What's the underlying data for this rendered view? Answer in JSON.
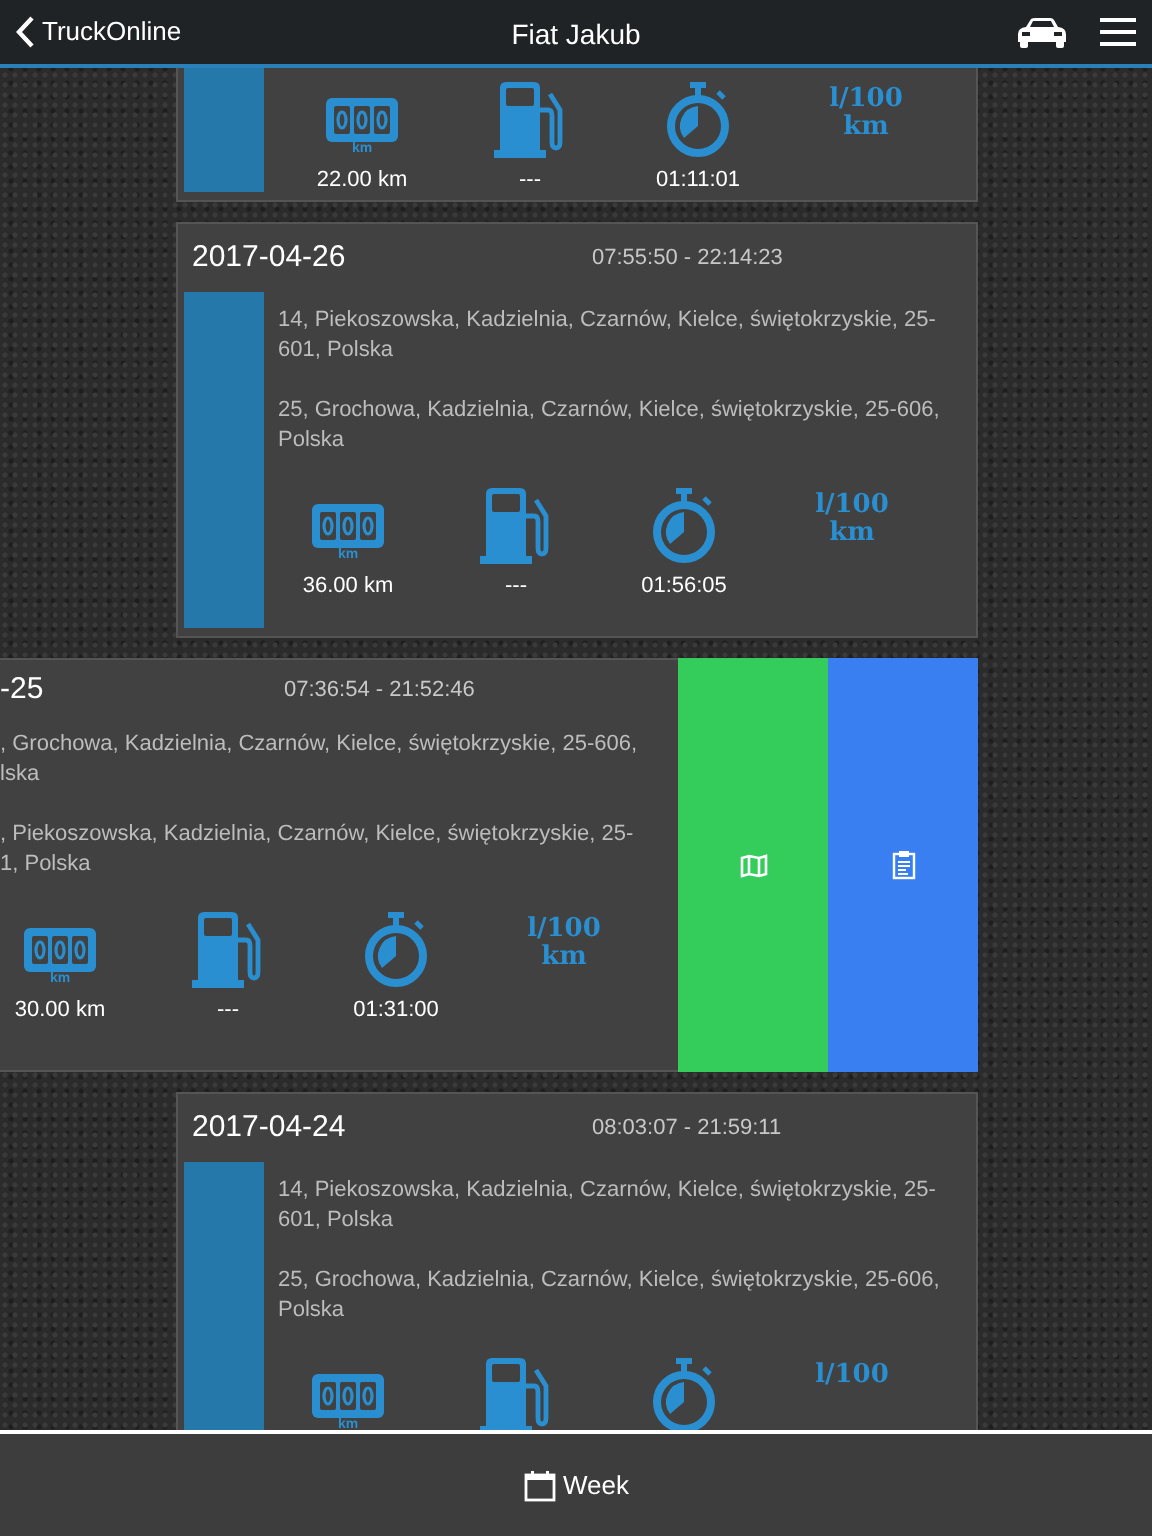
{
  "header": {
    "back_label": "TruckOnline",
    "title": "Fiat Jakub"
  },
  "trips": [
    {
      "kind": "partial",
      "odometer_unit": "km",
      "distance": "22.00 km",
      "fuel": "---",
      "duration": "01:11:01",
      "consumption": "l/100 km"
    },
    {
      "kind": "normal",
      "date": "2017-04-26",
      "time_range": "07:55:50 - 22:14:23",
      "addresses": [
        "14, Piekoszowska, Kadzielnia, Czarnów, Kielce, świętokrzyskie, 25-601, Polska",
        "25, Grochowa, Kadzielnia, Czarnów, Kielce, świętokrzyskie, 25-606, Polska"
      ],
      "odometer_unit": "km",
      "distance": "36.00 km",
      "fuel": "---",
      "duration": "01:56:05",
      "consumption": "l/100 km"
    },
    {
      "kind": "swiped",
      "date": "-25",
      "time_range": "07:36:54 - 21:52:46",
      "address_lines": [
        [
          ", Grochowa, Kadzielnia, Czarnów, Kielce, świętokrzyskie, 25-606,",
          "lska"
        ],
        [
          ", Piekoszowska, Kadzielnia, Czarnów, Kielce, świętokrzyskie, 25-",
          "1, Polska"
        ]
      ],
      "odometer_unit": "km",
      "distance": "30.00 km",
      "fuel": "---",
      "duration": "01:31:00",
      "consumption": "l/100 km"
    },
    {
      "kind": "normal",
      "date": "2017-04-24",
      "time_range": "08:03:07 - 21:59:11",
      "addresses": [
        "14, Piekoszowska, Kadzielnia, Czarnów, Kielce, świętokrzyskie, 25-601, Polska",
        "25, Grochowa, Kadzielnia, Czarnów, Kielce, świętokrzyskie, 25-606, Polska"
      ],
      "odometer_unit": "km",
      "consumption": "l/100"
    }
  ],
  "footer": {
    "label": "Week"
  }
}
